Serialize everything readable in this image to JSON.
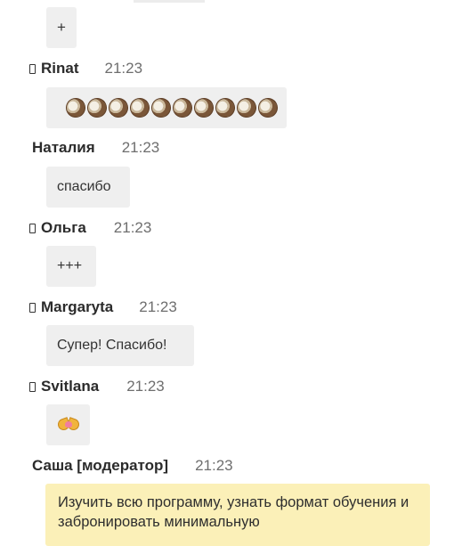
{
  "messages": [
    {
      "author": "",
      "time": "",
      "text": "+"
    },
    {
      "author": "Rinat",
      "time": "21:23",
      "emoji": "coconut",
      "emoji_count": 10
    },
    {
      "author": "Наталия",
      "time": "21:23",
      "text": "спасибо"
    },
    {
      "author": "Ольга",
      "time": "21:23",
      "text": "+++"
    },
    {
      "author": "Margaryta",
      "time": "21:23",
      "text": "Супер! Спасибо!"
    },
    {
      "author": "Svitlana",
      "time": "21:23",
      "emoji": "heart-hands"
    },
    {
      "author": "Саша [модератор]",
      "time": "21:23",
      "text": "Изучить всю программу, узнать формат обучения и забронировать минимальную",
      "highlight_color": "#fbf0b8"
    }
  ]
}
